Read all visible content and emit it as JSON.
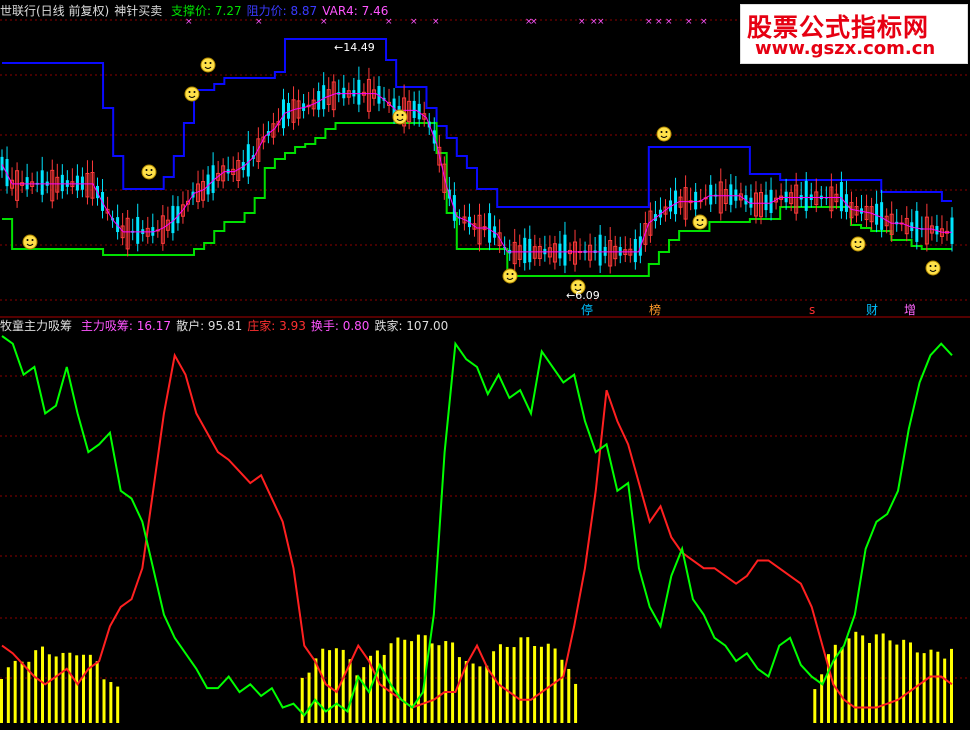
{
  "top_panel": {
    "title": "世联行(日线 前复权)",
    "indicator": "神针买卖",
    "items": [
      {
        "label": "支撑价:",
        "value": "7.27",
        "color": "#00e000"
      },
      {
        "label": "阻力价:",
        "value": "8.87",
        "color": "#3a3aff"
      },
      {
        "label": "VAR4:",
        "value": "7.46",
        "color": "#ff55ff"
      }
    ],
    "high_label": "14.49",
    "low_label": "6.09",
    "event_markers": [
      {
        "text": "停",
        "color": "#00c0ff"
      },
      {
        "text": "榜",
        "color": "#ff9a2a"
      },
      {
        "text": "s",
        "color": "#ff3030"
      },
      {
        "text": "财",
        "color": "#00c0ff"
      },
      {
        "text": "增",
        "color": "#ff66ff"
      }
    ]
  },
  "bottom_panel": {
    "title": "牧童主力吸筹",
    "items": [
      {
        "label": "主力吸筹:",
        "value": "16.17",
        "color": "#ff55ff"
      },
      {
        "label": "散户:",
        "value": "95.81",
        "color": "#dddddd"
      },
      {
        "label": "庄家:",
        "value": "3.93",
        "color": "#ff3030"
      },
      {
        "label": "换手:",
        "value": "0.80",
        "color": "#ff55ff"
      },
      {
        "label": "跌家:",
        "value": "107.00",
        "color": "#dddddd"
      }
    ]
  },
  "watermark": {
    "title": "股票公式指标网",
    "url": "www.gszx.com.cn"
  },
  "colors": {
    "background": "#000000",
    "grid": "#8b0000",
    "resistance": "#0a0aff",
    "support": "#00e000",
    "red_line": "#ff2020",
    "green_line": "#00ff00",
    "bars": "#ffff00",
    "magenta": "#ff00ff"
  },
  "chart_data": [
    {
      "type": "line",
      "name": "price",
      "resistance": [
        13.5,
        13.5,
        13.5,
        13.5,
        13.5,
        13.5,
        13.5,
        13.5,
        13.5,
        13.5,
        12.0,
        10.4,
        9.3,
        9.3,
        9.3,
        9.3,
        9.7,
        10.4,
        11.5,
        12.6,
        12.6,
        12.8,
        13.0,
        13.0,
        13.0,
        13.0,
        13.0,
        13.2,
        14.3,
        14.3,
        14.3,
        14.3,
        14.3,
        14.3,
        14.3,
        14.3,
        14.3,
        14.3,
        13.6,
        12.7,
        12.7,
        12.7,
        12.0,
        11.4,
        11.0,
        10.4,
        10.0,
        9.3,
        9.3,
        8.7,
        8.7,
        8.7,
        8.7,
        8.7,
        8.7,
        8.7,
        8.7,
        8.7,
        8.7,
        8.7,
        8.7,
        8.7,
        8.7,
        8.7,
        10.7,
        10.7,
        10.7,
        10.7,
        10.7,
        10.7,
        10.7,
        10.7,
        10.7,
        10.7,
        9.8,
        9.8,
        9.8,
        9.6,
        9.6,
        9.6,
        9.6,
        9.6,
        9.6,
        9.6,
        9.6,
        9.6,
        9.6,
        9.2,
        9.2,
        9.2,
        9.2,
        9.2,
        9.2,
        8.9,
        8.9
      ],
      "support": [
        8.3,
        7.3,
        7.3,
        7.3,
        7.3,
        7.3,
        7.3,
        7.3,
        7.3,
        7.3,
        7.1,
        7.1,
        7.1,
        7.1,
        7.1,
        7.1,
        7.1,
        7.1,
        7.1,
        7.3,
        7.5,
        7.9,
        8.2,
        8.2,
        8.5,
        9.0,
        10.0,
        10.3,
        10.5,
        10.7,
        10.8,
        11.0,
        11.3,
        11.5,
        11.5,
        11.5,
        11.5,
        11.5,
        11.5,
        11.5,
        11.5,
        11.5,
        11.5,
        10.5,
        8.5,
        7.3,
        7.3,
        7.3,
        7.3,
        7.3,
        6.4,
        6.4,
        6.4,
        6.4,
        6.4,
        6.4,
        6.4,
        6.4,
        6.4,
        6.4,
        6.4,
        6.4,
        6.4,
        6.4,
        6.8,
        7.2,
        7.6,
        7.9,
        7.9,
        7.9,
        8.2,
        8.2,
        8.2,
        8.2,
        8.3,
        8.3,
        8.3,
        8.7,
        8.7,
        8.7,
        8.7,
        8.7,
        8.7,
        8.7,
        8.1,
        8.0,
        7.9,
        7.9,
        7.6,
        7.6,
        7.4,
        7.3,
        7.3,
        7.3,
        7.3
      ]
    },
    {
      "type": "line",
      "name": "oscillator",
      "green_line": [
        100,
        98,
        90,
        92,
        80,
        82,
        92,
        80,
        70,
        72,
        75,
        60,
        58,
        52,
        40,
        28,
        22,
        18,
        14,
        9,
        9,
        12,
        8,
        10,
        7,
        9,
        4,
        5,
        2,
        6,
        3,
        5,
        3,
        12,
        8,
        15,
        10,
        6,
        4,
        8,
        28,
        70,
        98,
        94,
        92,
        85,
        90,
        84,
        86,
        80,
        96,
        92,
        88,
        90,
        78,
        70,
        72,
        60,
        62,
        40,
        30,
        25,
        38,
        45,
        32,
        28,
        22,
        20,
        16,
        18,
        14,
        12,
        20,
        22,
        15,
        12,
        10,
        16,
        20,
        28,
        45,
        52,
        54,
        60,
        76,
        88,
        95,
        98,
        95
      ],
      "red_line": [
        20,
        18,
        15,
        12,
        10,
        12,
        14,
        10,
        14,
        16,
        25,
        30,
        32,
        40,
        60,
        80,
        95,
        90,
        80,
        75,
        70,
        68,
        65,
        62,
        64,
        58,
        52,
        40,
        20,
        16,
        10,
        8,
        14,
        20,
        16,
        10,
        8,
        6,
        4,
        5,
        6,
        8,
        8,
        15,
        20,
        14,
        10,
        8,
        6,
        6,
        8,
        10,
        12,
        25,
        40,
        60,
        86,
        78,
        72,
        62,
        52,
        56,
        48,
        44,
        42,
        40,
        40,
        38,
        36,
        38,
        42,
        42,
        40,
        38,
        36,
        30,
        20,
        10,
        6,
        4,
        4,
        4,
        5,
        6,
        8,
        10,
        12,
        12,
        10
      ]
    }
  ]
}
